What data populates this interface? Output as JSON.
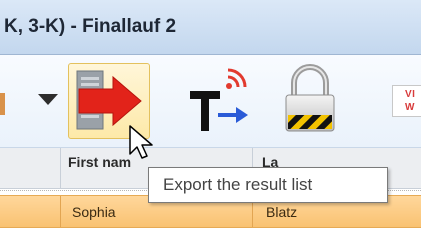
{
  "window": {
    "title": "K, 3-K) - Finallauf 2"
  },
  "toolbar": {
    "export_icon": "export-arrow-icon",
    "text_icon": "text-signal-icon",
    "lock_icon": "padlock-icon",
    "partial_label": "VI W",
    "partial_lines": [
      "VI",
      "W"
    ]
  },
  "grid": {
    "headers": [
      "First nam",
      "La"
    ],
    "rows": [
      {
        "first_name": "Sophia",
        "last_name": "Blatz"
      }
    ]
  },
  "tooltip": {
    "text": "Export the result list"
  },
  "colors": {
    "title_bar": "#c3d7ee",
    "selected_row": "#f9c272",
    "export_arrow": "#e2231a"
  }
}
